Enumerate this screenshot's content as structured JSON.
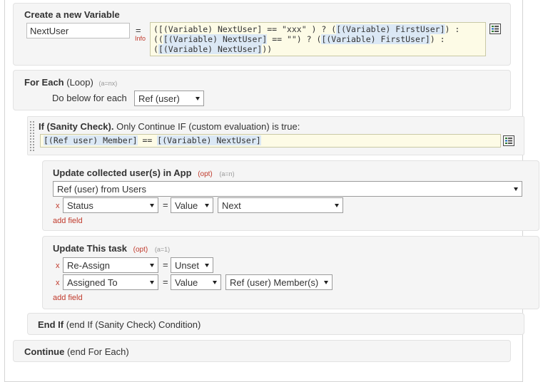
{
  "create_variable": {
    "title": "Create a new Variable",
    "name_value": "NextUser",
    "equals": "=",
    "info_label": "Info",
    "expression_line1_pre": "([(Variable) NextUser] == \"xxx\" ) ? (",
    "expression_line1_hl": "[(Variable) FirstUser]",
    "expression_line1_post": ") :",
    "expression_line2_pre": "((",
    "expression_line2_hl1": "[(Variable) NextUser]",
    "expression_line2_mid": " == \"\") ? (",
    "expression_line2_hl2": "[(Variable) FirstUser]",
    "expression_line2_post": ") :",
    "expression_line3_pre": "(",
    "expression_line3_hl": "[(Variable) NextUser]",
    "expression_line3_post": "))"
  },
  "for_each": {
    "title_bold": "For Each",
    "title_normal": "(Loop)",
    "tag": "(a=nx)",
    "do_below_label": "Do below for each",
    "select_value": "Ref (user)"
  },
  "if_check": {
    "title_bold": "If (Sanity Check).",
    "title_normal": "Only Continue IF (custom evaluation) is true:",
    "expr_hl1": "[(Ref user) Member]",
    "expr_mid": " == ",
    "expr_hl2": "[(Variable) NextUser]"
  },
  "update_collected": {
    "title": "Update collected user(s) in App",
    "opt": "(opt)",
    "tag": "(a=n)",
    "source_select": "Ref (user) from Users",
    "row": {
      "remove": "x",
      "field": "Status",
      "equals": "=",
      "mode": "Value",
      "value": "Next"
    },
    "add_field": "add field"
  },
  "update_task": {
    "title": "Update This task",
    "opt": "(opt)",
    "tag": "(a=1)",
    "rows": [
      {
        "remove": "x",
        "field": "Re-Assign",
        "equals": "=",
        "mode": "Unset"
      },
      {
        "remove": "x",
        "field": "Assigned To",
        "equals": "=",
        "mode": "Value",
        "value": "Ref (user) Member(s)"
      }
    ],
    "add_field": "add field"
  },
  "end_if": {
    "title_bold": "End If",
    "title_normal": "(end If (Sanity Check) Condition)"
  },
  "continue": {
    "title_bold": "Continue",
    "title_normal": "(end For Each)"
  },
  "colors": {
    "accent_red": "#c0392b",
    "expr_bg": "#fdfbe6",
    "highlight": "#dbe8f5",
    "panel_bg": "#f5f5f5"
  }
}
